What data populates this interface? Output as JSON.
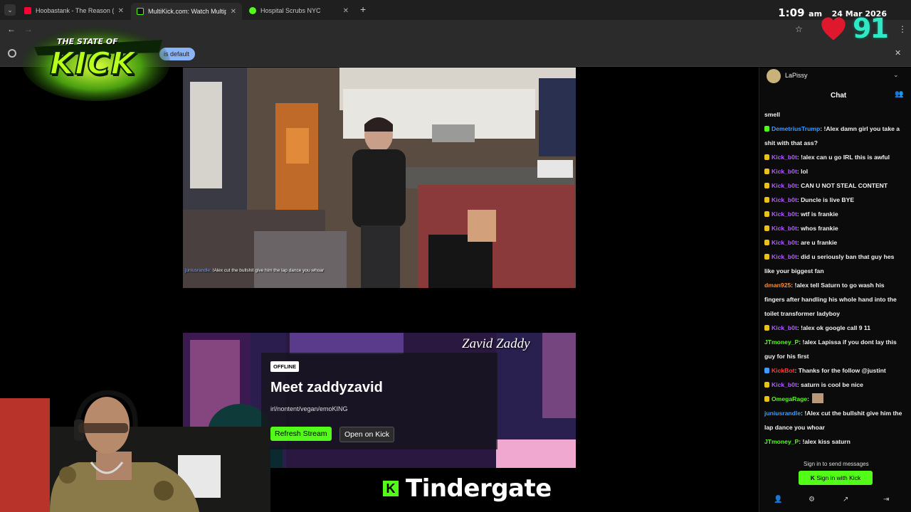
{
  "browser": {
    "tabs": [
      {
        "title": "Hoobastank - The Reason (Lyric",
        "favicon_color": "#ff0033",
        "active": false
      },
      {
        "title": "MultiKick.com: Watch Multiple",
        "favicon_color": "#53fc18",
        "active": true
      },
      {
        "title": "Hospital Scrubs NYC",
        "favicon_color": "#53fc18",
        "active": false
      }
    ],
    "new_tab": "+",
    "info_pill": "is default"
  },
  "overlay": {
    "clock_time": "1:09",
    "clock_ampm": "am",
    "clock_date": "24 Mar 2026",
    "heart_count": "91",
    "logo_line1": "THE STATE OF",
    "logo_line2": "KICK",
    "banner_text": "Tindergate"
  },
  "video1": {
    "chat_overlay_user": "juniusrandle:",
    "chat_overlay_text": "!Alex cut the bullshit give him the lap dance you whoar"
  },
  "offline_card": {
    "banner_name": "Zavid Zaddy",
    "status_label": "OFFLINE",
    "heading": "Meet zaddyzavid",
    "description": "irl/nontent/vegan/emoKING",
    "refresh_label": "Refresh Stream",
    "open_label": "Open on Kick"
  },
  "chat": {
    "channel": "LaPissy",
    "title": "Chat",
    "messages": [
      {
        "user": "",
        "text": "smell",
        "color": "#ffffff",
        "badge": ""
      },
      {
        "user": "DemetriusTrump",
        "text": "!Alex damn girl you take a shit with that ass?",
        "color": "#3d9cff",
        "badge": "#53fc18"
      },
      {
        "user": "Kick_b0t",
        "text": "!alex can u go IRL this is awful",
        "color": "#b35cff",
        "badge": "#e8c21a"
      },
      {
        "user": "Kick_b0t",
        "text": "lol",
        "color": "#b35cff",
        "badge": "#e8c21a"
      },
      {
        "user": "Kick_b0t",
        "text": "CAN U NOT STEAL CONTENT",
        "color": "#b35cff",
        "badge": "#e8c21a"
      },
      {
        "user": "Kick_b0t",
        "text": "Duncle is live BYE",
        "color": "#b35cff",
        "badge": "#e8c21a"
      },
      {
        "user": "Kick_b0t",
        "text": "wtf is frankie",
        "color": "#b35cff",
        "badge": "#e8c21a"
      },
      {
        "user": "Kick_b0t",
        "text": "whos frankie",
        "color": "#b35cff",
        "badge": "#e8c21a"
      },
      {
        "user": "Kick_b0t",
        "text": "are u frankie",
        "color": "#b35cff",
        "badge": "#e8c21a"
      },
      {
        "user": "Kick_b0t",
        "text": "did u seriously ban that guy hes like your biggest fan",
        "color": "#b35cff",
        "badge": "#e8c21a"
      },
      {
        "user": "dman925",
        "text": "!alex tell Saturn to go wash his fingers after handling his whole hand into the toilet transformer ladyboy",
        "color": "#ff8a2b",
        "badge": ""
      },
      {
        "user": "Kick_b0t",
        "text": "!alex ok google call 9 11",
        "color": "#b35cff",
        "badge": "#e8c21a"
      },
      {
        "user": "JTmoney_P",
        "text": "!alex Lapissa if you dont lay this guy for his first",
        "color": "#53fc18",
        "badge": ""
      },
      {
        "user": "KickBot",
        "text": "Thanks for the follow @justint",
        "color": "#ff3b3b",
        "badge": "#3d9cff"
      },
      {
        "user": "Kick_b0t",
        "text": "saturn is cool be nice",
        "color": "#b35cff",
        "badge": "#e8c21a"
      },
      {
        "user": "OmegaRage",
        "text": "",
        "color": "#53fc18",
        "badge": "#e8c21a"
      },
      {
        "user": "juniusrandle",
        "text": "!Alex cut the bullshit give him the lap dance you whoar",
        "color": "#3d9cff",
        "badge": ""
      },
      {
        "user": "JTmoney_P",
        "text": "!alex kiss saturn",
        "color": "#53fc18",
        "badge": ""
      }
    ],
    "signin_prompt": "Sign in to send messages",
    "signin_button": "Sign in with Kick"
  }
}
